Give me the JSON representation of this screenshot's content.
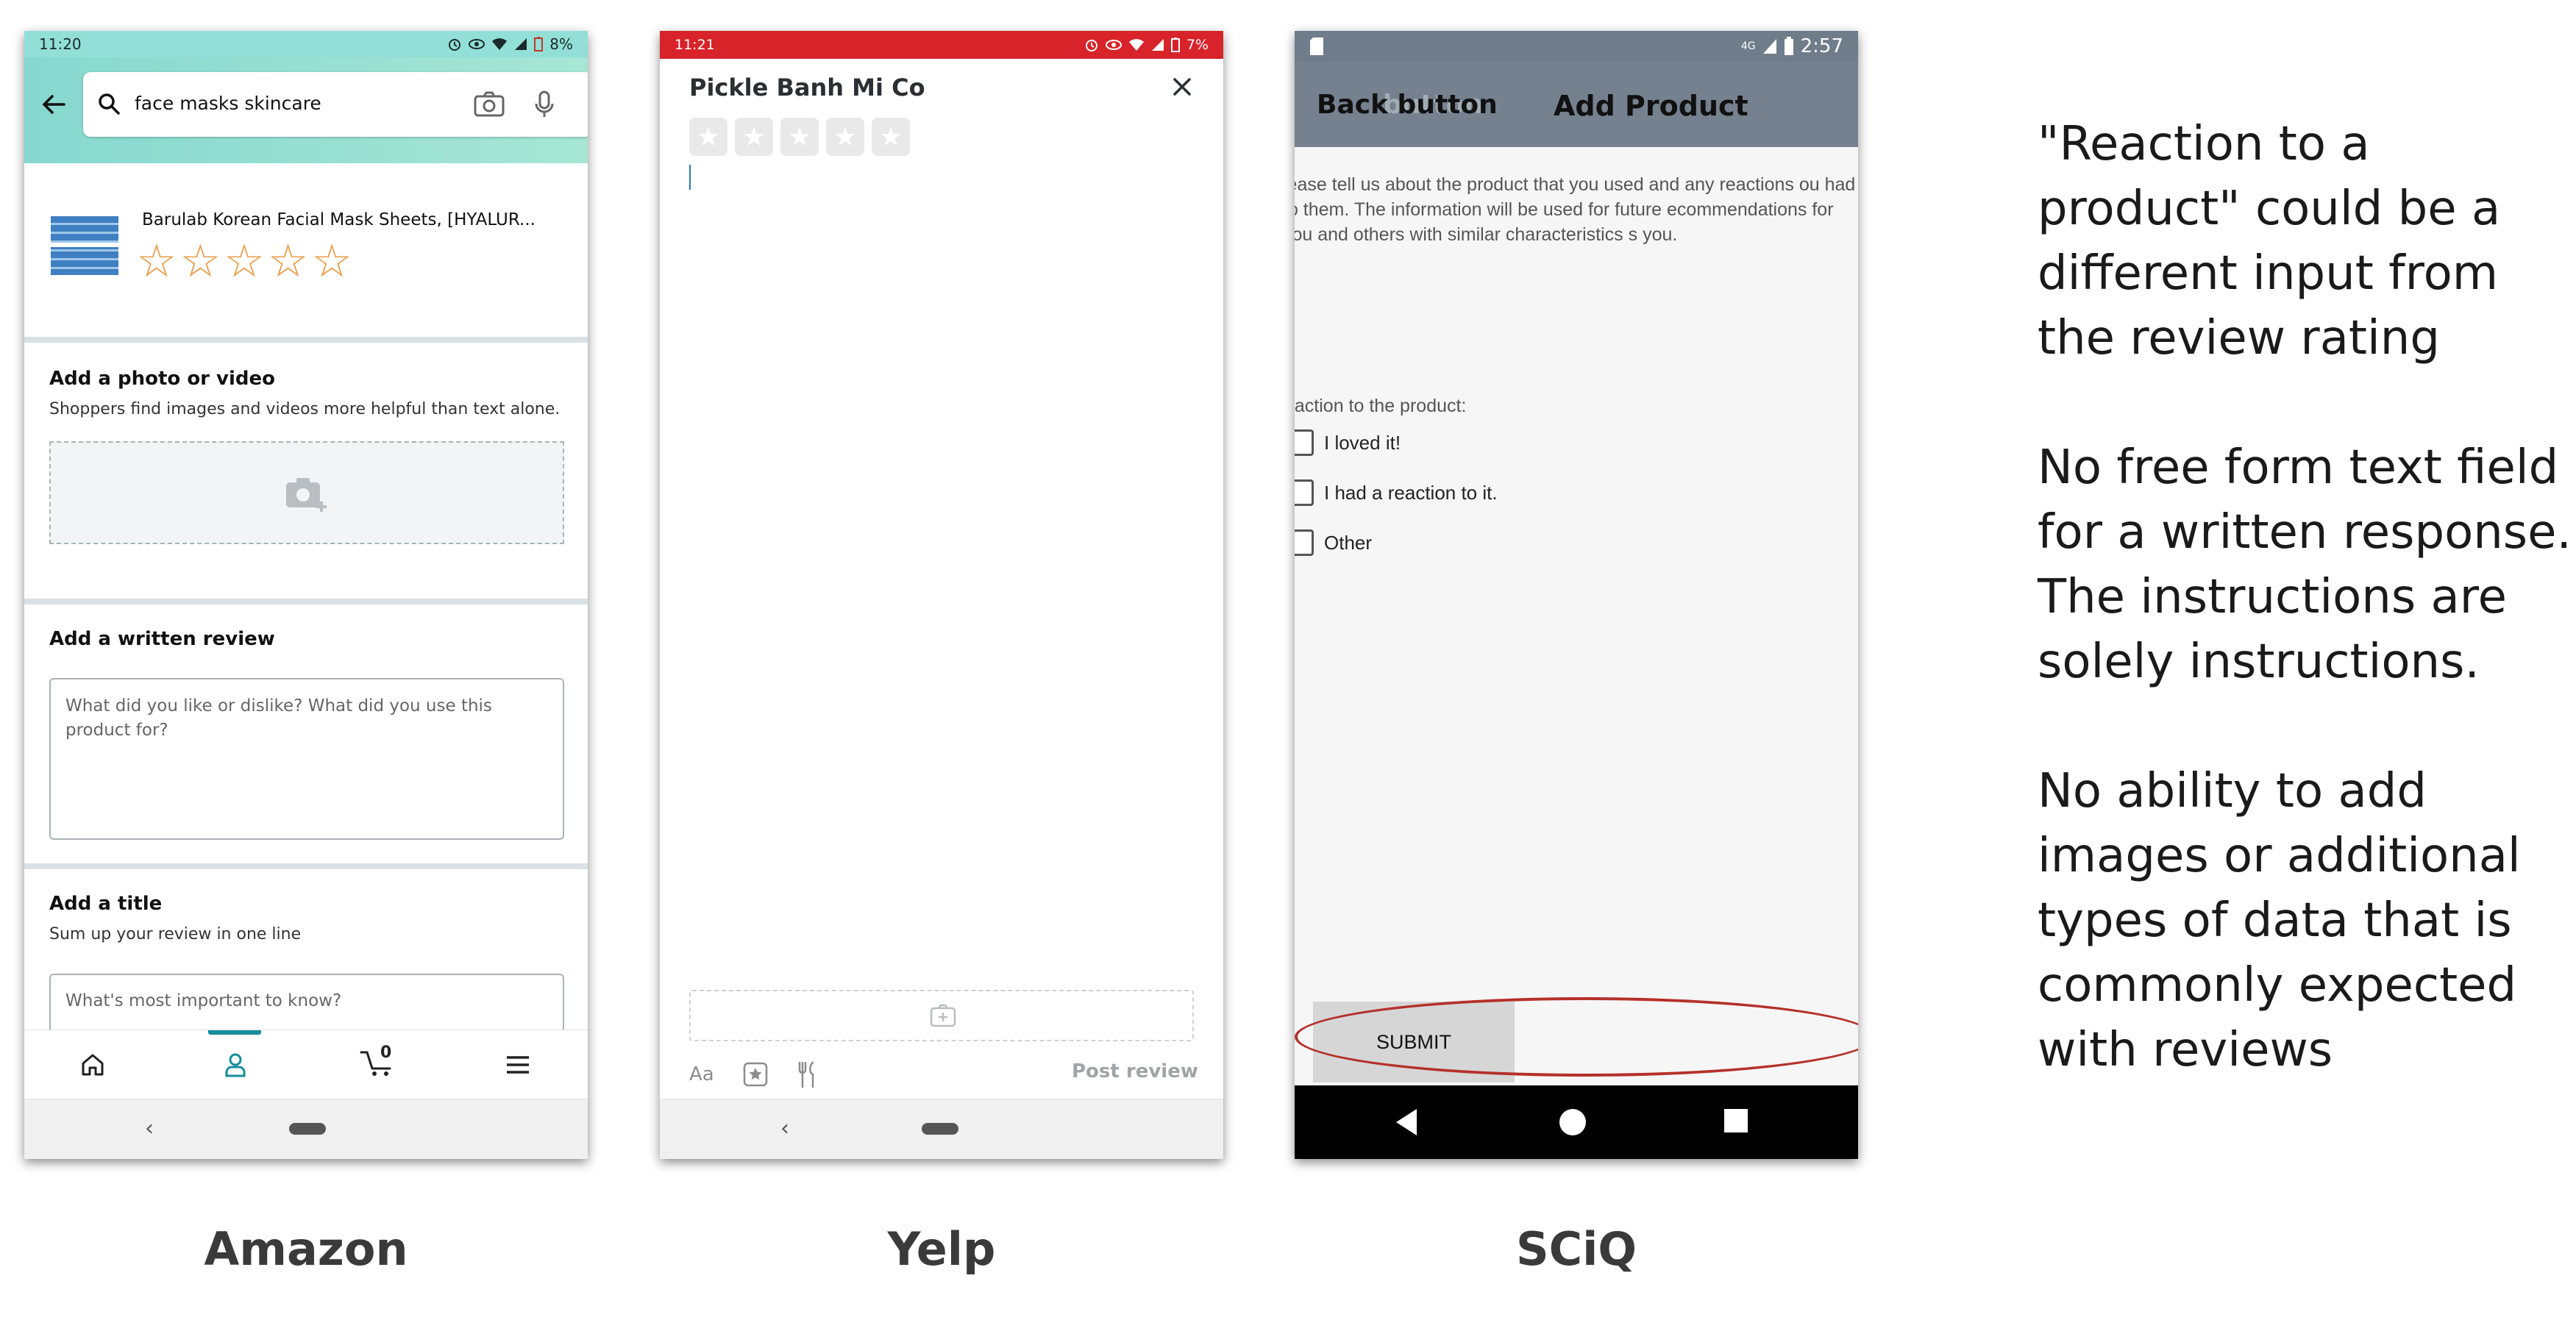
{
  "amazon": {
    "status_time": "11:20",
    "status_battery": "8%",
    "search_query": "face masks skincare",
    "product_name": "Barulab Korean Facial Mask Sheets, [HYALUR...",
    "photo_title": "Add a photo or video",
    "photo_sub": "Shoppers find images and videos more helpful than text alone.",
    "review_title": "Add a written review",
    "review_placeholder": "What did you like or dislike? What did you use this product for?",
    "title_heading": "Add a title",
    "title_sub": "Sum up your review in one line",
    "title_placeholder": "What's most important to know?",
    "cart_count": "0",
    "rating_stars": 0,
    "icons": [
      "back-arrow-icon",
      "search-icon",
      "camera-icon",
      "microphone-icon",
      "add-photo-icon",
      "home-icon",
      "account-icon",
      "cart-icon",
      "menu-icon"
    ]
  },
  "yelp": {
    "status_time": "11:21",
    "status_battery": "7%",
    "business_name": "Pickle Banh Mi Co",
    "format_label": "Aa",
    "post_label": "Post review",
    "rating_stars": 0,
    "accent": "#d8232a",
    "icons": [
      "close-icon",
      "star-icon",
      "add-photo-icon",
      "star-badge-icon",
      "utensils-icon"
    ]
  },
  "sciq": {
    "status_time": "2:57",
    "status_network": "4G",
    "back_label": "Back button",
    "back_ghost": "button",
    "page_title": "Add Product",
    "intro": "lease tell us about the product that you used and any reactions ou had to them. The information will be used for future ecommendations for you and others with similar characteristics s you.",
    "reaction_label": "eaction to the product:",
    "options": [
      "I loved it!",
      "I had a reaction to it.",
      "Other"
    ],
    "submit_label": "SUBMIT",
    "highlight_color": "#b5302a"
  },
  "captions": {
    "amazon": "Amazon",
    "yelp": "Yelp",
    "sciq": "SCiQ"
  },
  "notes": [
    "\"Reaction to a product\" could be a different input from the review rating",
    "No free form text field for a written response. The instructions are solely instructions.",
    "No ability to add images or additional types of data that is commonly expected with reviews"
  ]
}
